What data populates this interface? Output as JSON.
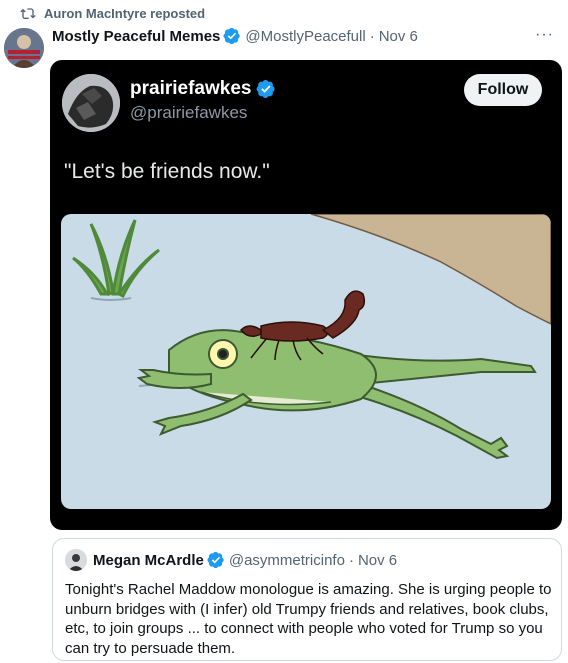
{
  "repost": {
    "text": "Auron MacIntyre reposted",
    "icon": "repost-icon"
  },
  "post": {
    "author_name": "Mostly Peaceful Memes",
    "handle": "@MostlyPeacefull",
    "separator": "·",
    "date": "Nov 6",
    "more_label": "···"
  },
  "embedded": {
    "author_name": "prairiefawkes",
    "handle": "@prairiefawkes",
    "follow_label": "Follow",
    "text": "\"Let's be friends now.\""
  },
  "quote": {
    "author_name": "Megan McArdle",
    "handle": "@asymmetricinfo",
    "separator": "·",
    "date": "Nov 6",
    "text": "Tonight's Rachel Maddow monologue is amazing. She is urging people to unburn bridges with (I infer) old Trumpy friends and relatives, book clubs, etc, to join groups ... to connect with people who voted for Trump so you can try to persuade them."
  },
  "colors": {
    "verified": "#1d9bf0",
    "muted_text": "#536471",
    "card_bg": "#000000",
    "water": "#c9dbe6",
    "shore": "#c9b594",
    "frog": "#8fbe70",
    "scorpion": "#6a2a21"
  }
}
